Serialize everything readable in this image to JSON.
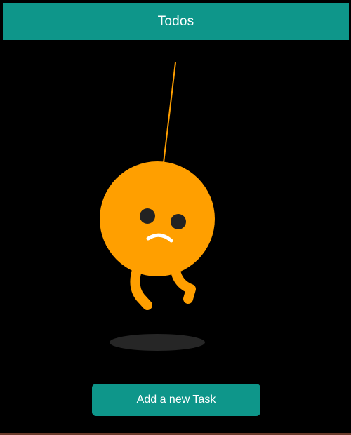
{
  "app_bar": {
    "title": "Todos"
  },
  "empty_state": {
    "illustration_icon": "hanging-sad-ball-character",
    "character_color": "#FF9F00",
    "face_color": "#222222",
    "mouth_color": "#FFFFFF",
    "shadow_color": "#2a2a2a"
  },
  "actions": {
    "add_task_label": "Add a new Task"
  },
  "colors": {
    "accent": "#0E968A",
    "background": "#000000"
  }
}
